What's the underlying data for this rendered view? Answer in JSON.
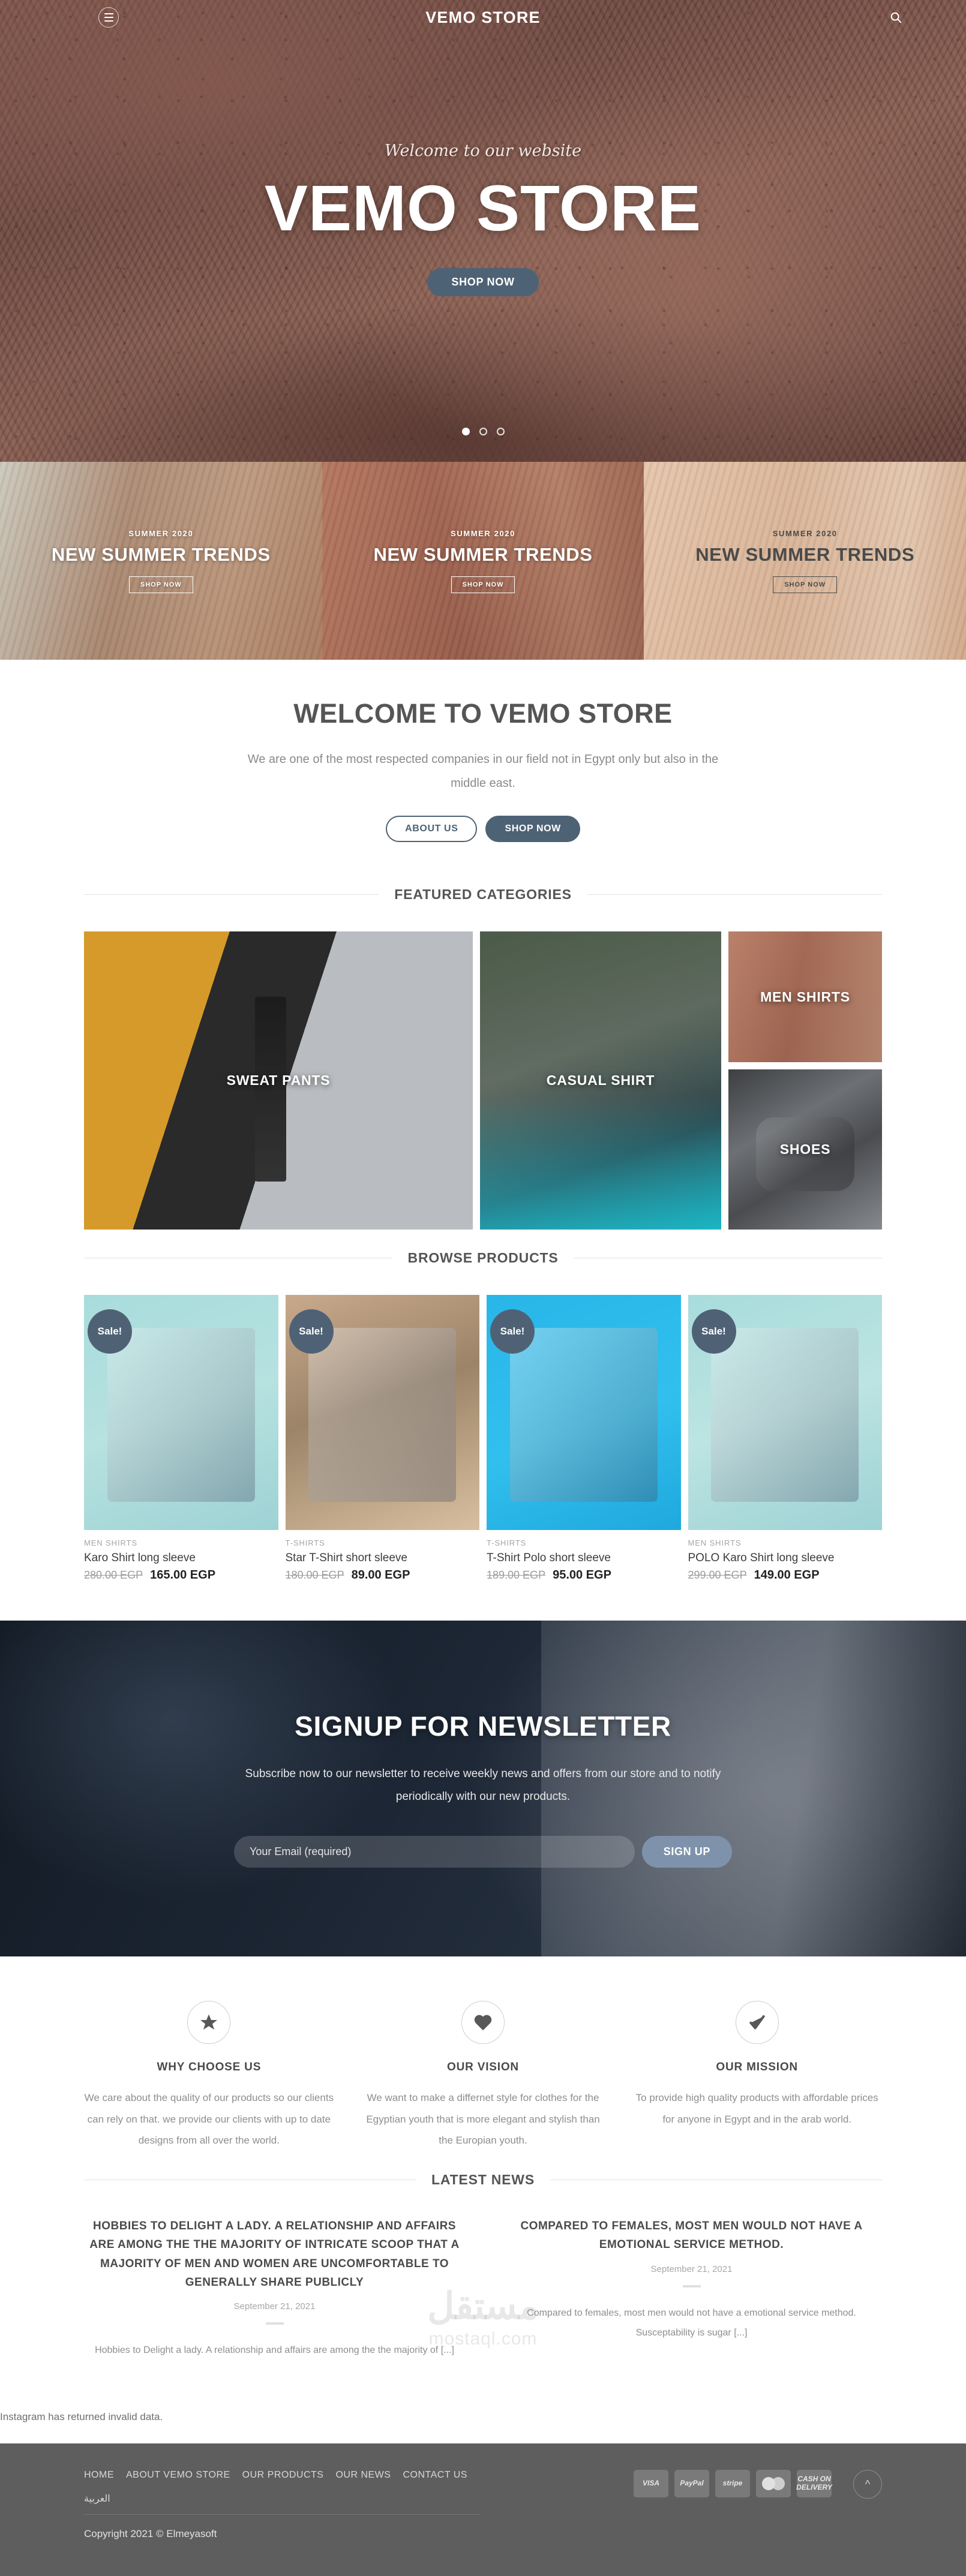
{
  "header": {
    "brand": "VEMO STORE",
    "menu_icon": "hamburger-menu-icon",
    "search_icon": "search-icon"
  },
  "hero": {
    "kicker": "Welcome to our website",
    "title": "VEMO STORE",
    "cta": "SHOP NOW",
    "dots": 3,
    "active_dot": 0
  },
  "banners": [
    {
      "kicker": "SUMMER 2020",
      "title": "NEW SUMMER TRENDS",
      "cta": "SHOP NOW",
      "text_tone": "light"
    },
    {
      "kicker": "SUMMER 2020",
      "title": "NEW SUMMER TRENDS",
      "cta": "SHOP NOW",
      "text_tone": "light"
    },
    {
      "kicker": "SUMMER 2020",
      "title": "NEW SUMMER TRENDS",
      "cta": "SHOP NOW",
      "text_tone": "dark"
    }
  ],
  "welcome": {
    "heading": "WELCOME TO VEMO STORE",
    "body": "We are one of the most respected companies in our field not in Egypt only but also in the middle east.",
    "btn_about": "ABOUT US",
    "btn_shop": "SHOP NOW"
  },
  "featured_categories": {
    "heading": "FEATURED CATEGORIES",
    "items": [
      {
        "label": "SWEAT PANTS"
      },
      {
        "label": "CASUAL SHIRT"
      },
      {
        "label": "MEN SHIRTS"
      },
      {
        "label": "SHOES"
      }
    ]
  },
  "browse_products": {
    "heading": "BROWSE PRODUCTS",
    "sale_badge": "Sale!",
    "items": [
      {
        "category": "MEN SHIRTS",
        "name": "Karo Shirt long sleeve",
        "old_price": "280.00 EGP",
        "new_price": "165.00 EGP"
      },
      {
        "category": "T-SHIRTS",
        "name": "Star T-Shirt short sleeve",
        "old_price": "180.00 EGP",
        "new_price": "89.00 EGP"
      },
      {
        "category": "T-SHIRTS",
        "name": "T-Shirt Polo short sleeve",
        "old_price": "189.00 EGP",
        "new_price": "95.00 EGP"
      },
      {
        "category": "MEN SHIRTS",
        "name": "POLO Karo Shirt long sleeve",
        "old_price": "299.00 EGP",
        "new_price": "149.00 EGP"
      }
    ]
  },
  "newsletter": {
    "heading": "SIGNUP FOR NEWSLETTER",
    "body": "Subscribe now to our newsletter to receive weekly news and offers from our store and to notify periodically with our new products.",
    "input_placeholder": "Your Email (required)",
    "input_value": "",
    "submit": "SIGN UP"
  },
  "features": [
    {
      "icon": "star-icon",
      "title": "WHY CHOOSE US",
      "body": "We care about the quality of our products so our clients can rely on that. we provide our clients with up to date designs from all over the world."
    },
    {
      "icon": "heart-icon",
      "title": "OUR VISION",
      "body": "We want to make a differnet style for clothes for the Egyptian youth that is more elegant and stylish than the Europian youth."
    },
    {
      "icon": "check-icon",
      "title": "OUR MISSION",
      "body": "To provide high quality products with affordable prices for anyone in Egypt and in the arab world."
    }
  ],
  "latest_news": {
    "heading": "LATEST NEWS",
    "posts": [
      {
        "title": "HOBBIES TO DELIGHT A LADY. A RELATIONSHIP AND AFFAIRS ARE AMONG THE THE MAJORITY OF INTRICATE SCOOP THAT A MAJORITY OF MEN AND WOMEN ARE UNCOMFORTABLE TO GENERALLY SHARE PUBLICLY",
        "date": "September 21, 2021",
        "excerpt": "Hobbies to Delight a lady. A relationship and affairs are among the the majority of [...]"
      },
      {
        "title": "COMPARED TO FEMALES, MOST MEN WOULD NOT HAVE A EMOTIONAL SERVICE METHOD.",
        "date": "September 21, 2021",
        "excerpt": "Compared to females, most men would not have a emotional service method. Susceptability is sugar [...]"
      }
    ]
  },
  "instagram_notice": "Instagram has returned invalid data.",
  "footer": {
    "nav": [
      "HOME",
      "ABOUT VEMO STORE",
      "OUR PRODUCTS",
      "OUR NEWS",
      "CONTACT US",
      "العربية"
    ],
    "copyright": "Copyright 2021 © Elmeyasoft",
    "payments": [
      "VISA",
      "PayPal",
      "stripe",
      "MasterCard",
      "CASH ON DELIVERY"
    ],
    "to_top_icon": "chevron-up-icon"
  },
  "watermark": {
    "arabic": "مستقل",
    "latin": "mostaql.com"
  },
  "colors": {
    "accent": "#4e6275",
    "sale_badge": "#4f6275",
    "newsletter_bg": "#1b2430",
    "footer_bg": "#5e5e5e",
    "newsletter_button": "#7e93ab"
  }
}
